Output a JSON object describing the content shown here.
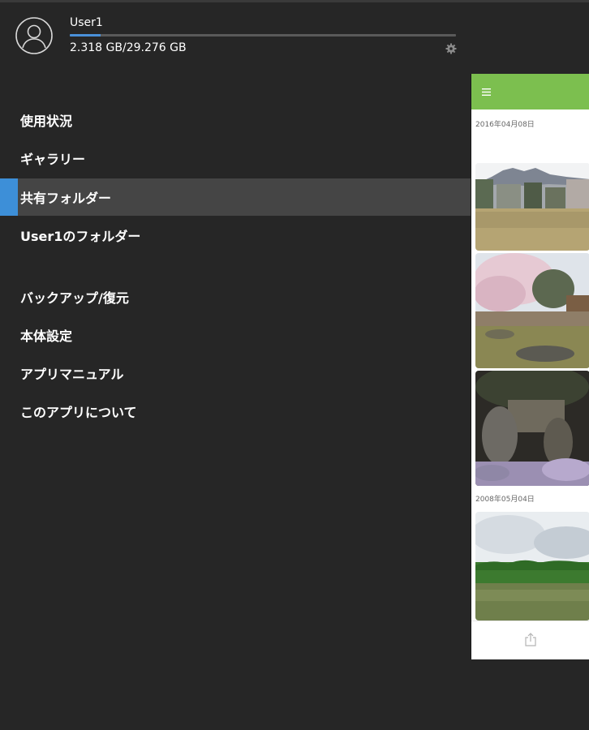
{
  "user": {
    "name": "User1",
    "storage_text": "2.318 GB/29.276 GB",
    "storage_fraction": 0.079
  },
  "menu": {
    "primary": [
      {
        "label": "使用状況",
        "active": false
      },
      {
        "label": "ギャラリー",
        "active": false
      },
      {
        "label": "共有フォルダー",
        "active": true
      },
      {
        "label": "User1のフォルダー",
        "active": false
      }
    ],
    "secondary": [
      {
        "label": "バックアップ/復元"
      },
      {
        "label": "本体設定"
      },
      {
        "label": "アプリマニュアル"
      },
      {
        "label": "このアプリについて"
      }
    ]
  },
  "preview": {
    "date_1": "2016年04月08日",
    "date_2": "2008年05月04日"
  },
  "icons": {
    "avatar": "user-avatar-icon",
    "settings": "gear-icon",
    "menu": "hamburger-icon",
    "share": "share-icon"
  },
  "colors": {
    "background": "#262626",
    "active_item": "#454545",
    "accent": "#3d8fd8",
    "toolbar_green": "#7cbf4f"
  }
}
